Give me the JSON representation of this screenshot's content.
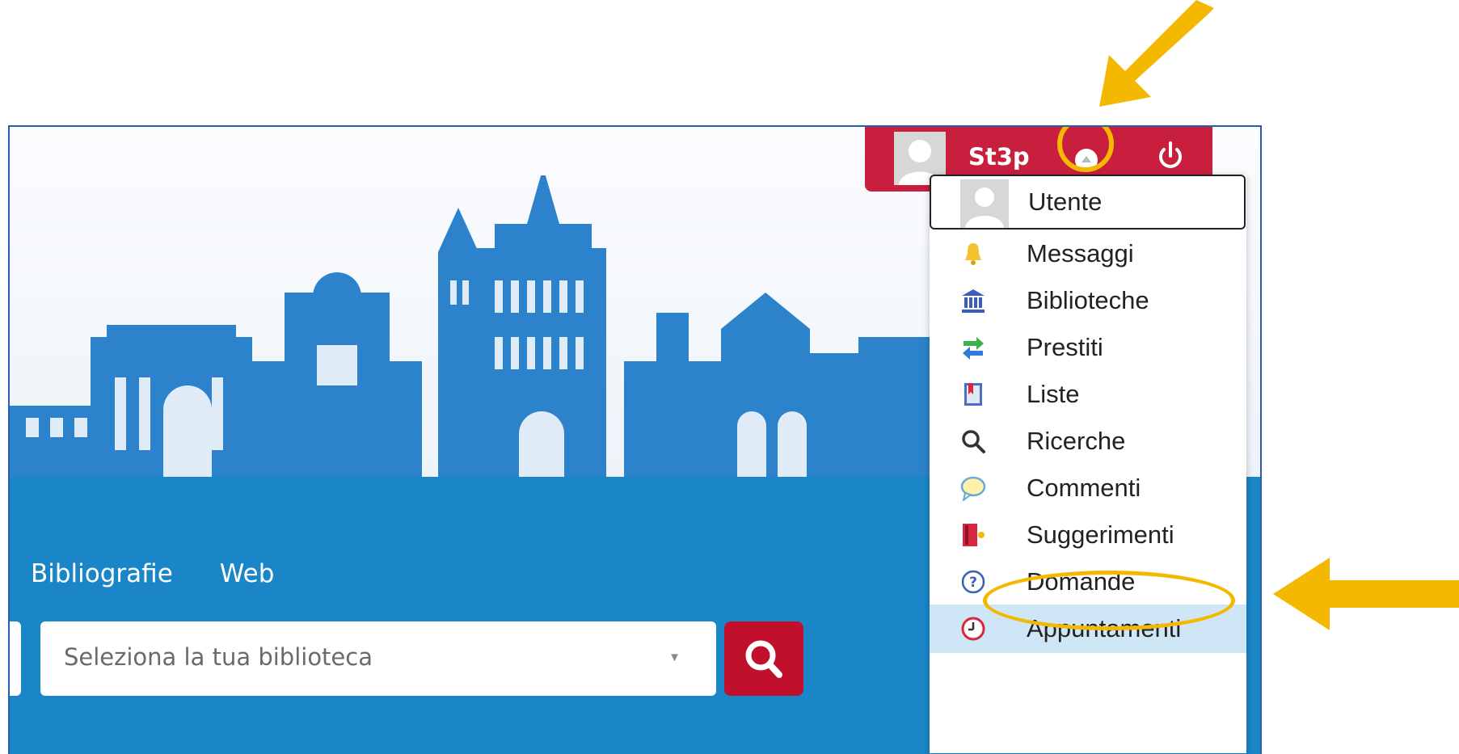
{
  "nav": {
    "items": [
      "Bibliografie",
      "Web"
    ]
  },
  "search": {
    "placeholder": "Seleziona la tua biblioteca"
  },
  "user": {
    "name": "St3p"
  },
  "menu": {
    "items": [
      {
        "label": "Utente",
        "icon": "user-icon"
      },
      {
        "label": "Messaggi",
        "icon": "bell-icon"
      },
      {
        "label": "Biblioteche",
        "icon": "library-icon"
      },
      {
        "label": "Prestiti",
        "icon": "transfer-arrows-icon"
      },
      {
        "label": "Liste",
        "icon": "bookmark-list-icon"
      },
      {
        "label": "Ricerche",
        "icon": "search-icon"
      },
      {
        "label": "Commenti",
        "icon": "speech-bubble-icon"
      },
      {
        "label": "Suggerimenti",
        "icon": "suggestion-book-icon"
      },
      {
        "label": "Domande",
        "icon": "question-icon"
      },
      {
        "label": "Appuntamenti",
        "icon": "clock-icon"
      }
    ]
  },
  "colors": {
    "brand_red": "#c81f3f",
    "band_blue": "#1a86c8",
    "highlight": "#f5b800",
    "active_row": "#cfe6f7"
  }
}
